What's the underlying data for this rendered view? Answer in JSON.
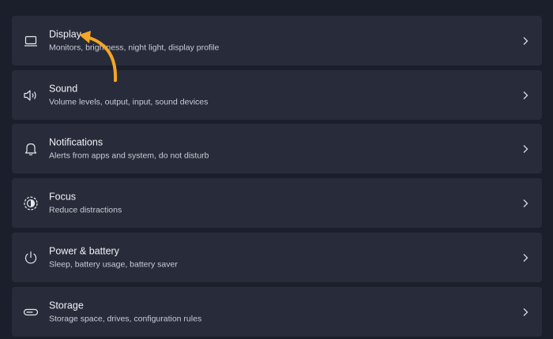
{
  "settings": {
    "items": [
      {
        "title": "Display",
        "description": "Monitors, brightness, night light, display profile",
        "icon": "monitor-icon"
      },
      {
        "title": "Sound",
        "description": "Volume levels, output, input, sound devices",
        "icon": "speaker-icon"
      },
      {
        "title": "Notifications",
        "description": "Alerts from apps and system, do not disturb",
        "icon": "bell-icon"
      },
      {
        "title": "Focus",
        "description": "Reduce distractions",
        "icon": "focus-icon"
      },
      {
        "title": "Power & battery",
        "description": "Sleep, battery usage, battery saver",
        "icon": "power-icon"
      },
      {
        "title": "Storage",
        "description": "Storage space, drives, configuration rules",
        "icon": "storage-icon"
      }
    ]
  },
  "annotation": {
    "arrow_color": "#f5a623",
    "arrow_icon": "curved-arrow-icon"
  },
  "colors": {
    "background": "#1b1f2b",
    "card": "#282c3a",
    "title_text": "#f2f3f6",
    "description_text": "#c8ccd6"
  }
}
